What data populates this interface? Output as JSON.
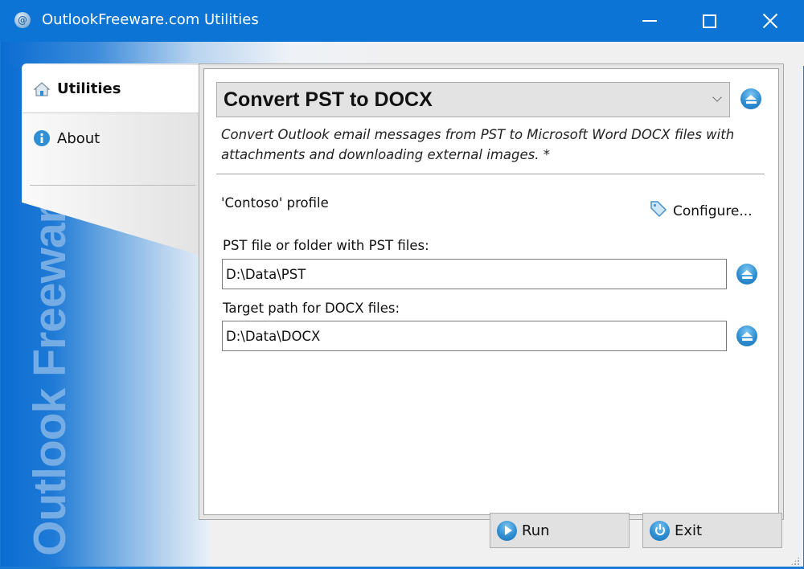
{
  "window": {
    "title": "OutlookFreeware.com Utilities",
    "app_icon": "outlookfreeware-logo-icon",
    "controls": {
      "minimize": "minimize-icon",
      "maximize": "maximize-icon",
      "close": "close-icon"
    }
  },
  "branding": {
    "vertical_text": "Outlook Freeware .com"
  },
  "sidebar": {
    "items": [
      {
        "label": "Utilities",
        "icon": "home-icon",
        "active": true
      },
      {
        "label": "About",
        "icon": "info-icon",
        "active": false
      }
    ]
  },
  "utility": {
    "selected": "Convert PST to DOCX",
    "description": "Convert Outlook email messages from PST to Microsoft Word DOCX files with attachments and downloading external images. *",
    "profile_label": "'Contoso' profile",
    "configure_label": "Configure...",
    "fields": [
      {
        "label": "PST file or folder with PST files:",
        "value": "D:\\Data\\PST"
      },
      {
        "label": "Target path for DOCX files:",
        "value": "D:\\Data\\DOCX"
      }
    ]
  },
  "footer": {
    "run_label": "Run",
    "exit_label": "Exit"
  },
  "colors": {
    "titlebar": "#0b74d4",
    "accent": "#2f8fd2"
  }
}
